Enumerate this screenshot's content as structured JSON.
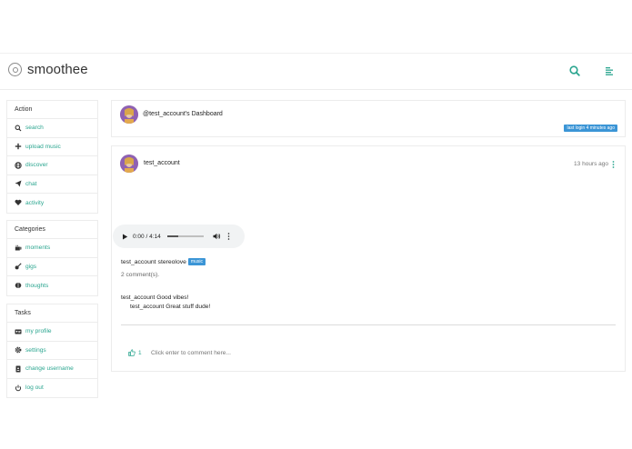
{
  "app": {
    "name": "smoothee",
    "brand_color": "#2aa58f"
  },
  "header": {
    "icons": [
      "search-icon",
      "menu-icon"
    ]
  },
  "sidebar": {
    "action": {
      "title": "Action",
      "items": [
        {
          "label": "search",
          "icon": "search-icon"
        },
        {
          "label": "upload music",
          "icon": "plus-icon"
        },
        {
          "label": "discover",
          "icon": "globe-icon"
        },
        {
          "label": "chat",
          "icon": "paper-plane-icon"
        },
        {
          "label": "activity",
          "icon": "heart-icon"
        }
      ]
    },
    "categories": {
      "title": "Categories",
      "items": [
        {
          "label": "moments",
          "icon": "coffee-icon"
        },
        {
          "label": "gigs",
          "icon": "guitar-icon"
        },
        {
          "label": "thoughts",
          "icon": "brain-icon"
        }
      ]
    },
    "tasks": {
      "title": "Tasks",
      "items": [
        {
          "label": "my profile",
          "icon": "id-card-icon"
        },
        {
          "label": "settings",
          "icon": "gear-icon"
        },
        {
          "label": "change username",
          "icon": "id-badge-icon"
        },
        {
          "label": "log out",
          "icon": "power-icon"
        }
      ]
    }
  },
  "dashboard": {
    "title": "@test_account's Dashboard",
    "last_login": "last login 4 minutes ago"
  },
  "post": {
    "username": "test_account",
    "time": "13 hours ago",
    "audio": {
      "time_display": "0:00 / 4:14",
      "progress": 0
    },
    "caption_user": "test_account",
    "caption_text": "stereolove",
    "tag": "music",
    "comment_count": "2 comment(s).",
    "comments": [
      {
        "user": "test_account",
        "text": "Good vibes!"
      },
      {
        "user": "test_account",
        "text": "Great stuff dude!"
      }
    ],
    "like_count": "1",
    "comment_placeholder": "Click enter to comment here..."
  }
}
